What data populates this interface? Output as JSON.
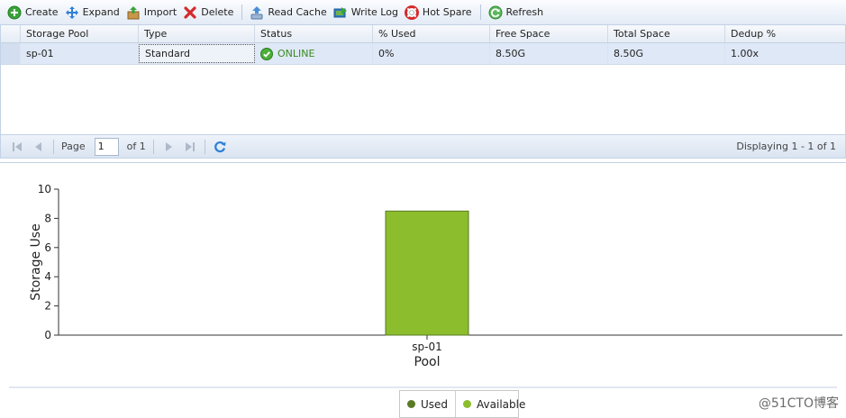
{
  "toolbar": {
    "create": "Create",
    "expand": "Expand",
    "import": "Import",
    "delete": "Delete",
    "read_cache": "Read Cache",
    "write_log": "Write Log",
    "hot_spare": "Hot Spare",
    "refresh": "Refresh"
  },
  "grid": {
    "columns": [
      "Storage Pool",
      "Type",
      "Status",
      "% Used",
      "Free Space",
      "Total Space",
      "Dedup %"
    ],
    "rows": [
      {
        "pool": "sp-01",
        "type": "Standard",
        "status": "ONLINE",
        "used": "0%",
        "free": "8.50G",
        "total": "8.50G",
        "dedup": "1.00x"
      }
    ]
  },
  "pager": {
    "page_label": "Page",
    "page_value": "1",
    "of_label": "of 1",
    "display_text": "Displaying 1 - 1 of 1"
  },
  "chart_data": {
    "type": "bar",
    "categories": [
      "sp-01"
    ],
    "series": [
      {
        "name": "Used",
        "values": [
          0
        ],
        "color": "#5a7a26"
      },
      {
        "name": "Available",
        "values": [
          8.5
        ],
        "color": "#8cbd2d"
      }
    ],
    "xlabel": "Pool",
    "ylabel": "Storage Use",
    "ylim": [
      0,
      10
    ],
    "yticks": [
      "0",
      "2",
      "4",
      "6",
      "8",
      "10"
    ],
    "stacked": true,
    "legend_position": "bottom"
  },
  "watermark": "@51CTO博客",
  "colors": {
    "online": "#3a8a1f",
    "accent": "#1e6fc6"
  }
}
